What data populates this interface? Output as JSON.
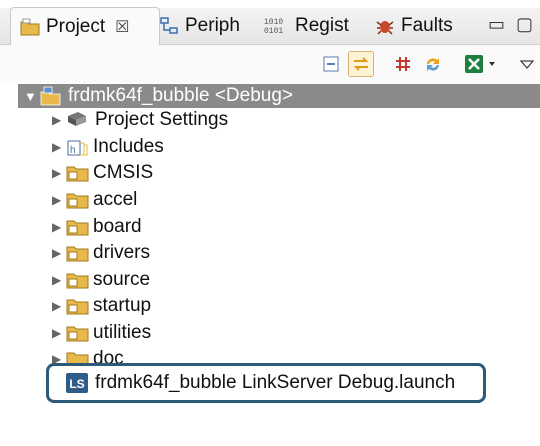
{
  "tabs": [
    {
      "label": "Project",
      "icon": "project-folder-icon",
      "active": true,
      "close": "☒"
    },
    {
      "label": "Periph",
      "icon": "peripherals-icon"
    },
    {
      "label": "Regist",
      "icon": "registers-icon"
    },
    {
      "label": "Faults",
      "icon": "faults-bug-icon"
    }
  ],
  "window_controls": {
    "minimize": "▭",
    "maximize": "▢"
  },
  "toolbar": {
    "buttons": [
      "collapse-all-icon",
      "link-editor-icon",
      "grid-icon",
      "refresh-icon",
      "excel-icon",
      "view-menu-icon"
    ]
  },
  "tree": {
    "root": {
      "label": "frdmk64f_bubble <Debug>",
      "expanded": true
    },
    "items": [
      {
        "label": "Project Settings",
        "icon": "settings-book-icon"
      },
      {
        "label": "Includes",
        "icon": "includes-icon"
      },
      {
        "label": "CMSIS",
        "icon": "source-folder-icon"
      },
      {
        "label": "accel",
        "icon": "source-folder-icon"
      },
      {
        "label": "board",
        "icon": "source-folder-icon"
      },
      {
        "label": "drivers",
        "icon": "source-folder-icon"
      },
      {
        "label": "source",
        "icon": "source-folder-icon"
      },
      {
        "label": "startup",
        "icon": "source-folder-icon"
      },
      {
        "label": "utilities",
        "icon": "source-folder-icon"
      },
      {
        "label": "doc",
        "icon": "folder-icon"
      }
    ],
    "launch_file": {
      "label": "frdmk64f_bubble LinkServer Debug.launch",
      "icon_text": "LS"
    }
  },
  "colors": {
    "selection": "#8a8a8a",
    "highlight_border": "#2c5a7a",
    "folder": "#e8b94a"
  }
}
